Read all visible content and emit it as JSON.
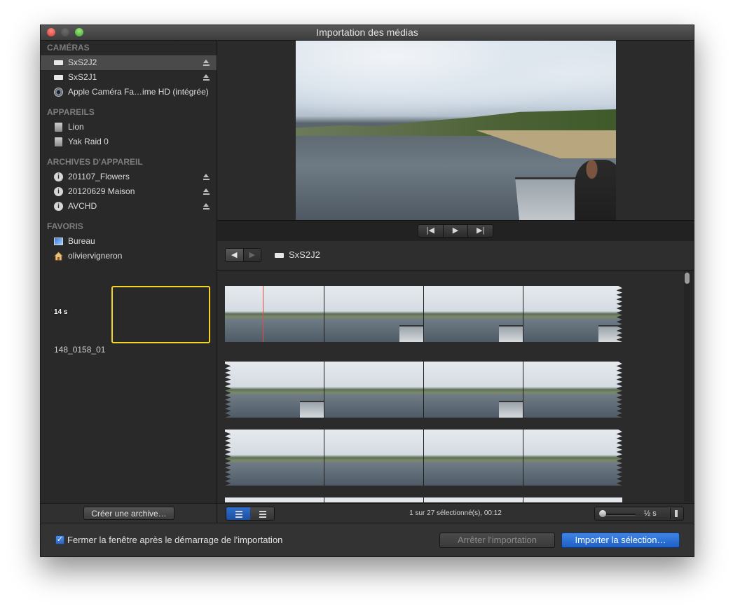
{
  "window": {
    "title": "Importation des médias"
  },
  "sidebar": {
    "sections": [
      {
        "title": "CAMÉRAS",
        "items": [
          {
            "label": "SxS2J2",
            "icon": "camera-icon",
            "eject": true,
            "selected": true
          },
          {
            "label": "SxS2J1",
            "icon": "camera-icon",
            "eject": true,
            "selected": false
          },
          {
            "label": "Apple Caméra Fa…ime HD (intégrée)",
            "icon": "facetime-camera-icon",
            "eject": false,
            "selected": false
          }
        ]
      },
      {
        "title": "APPAREILS",
        "items": [
          {
            "label": "Lion",
            "icon": "hard-disk-icon",
            "eject": false
          },
          {
            "label": "Yak Raid 0",
            "icon": "hard-disk-icon",
            "eject": false
          }
        ]
      },
      {
        "title": "ARCHIVES D'APPAREIL",
        "items": [
          {
            "label": "201107_Flowers",
            "icon": "archive-icon",
            "eject": true
          },
          {
            "label": "20120629 Maison",
            "icon": "archive-icon",
            "eject": true
          },
          {
            "label": "AVCHD",
            "icon": "archive-icon",
            "eject": true
          }
        ]
      },
      {
        "title": "FAVORIS",
        "items": [
          {
            "label": "Bureau",
            "icon": "desktop-icon",
            "eject": false
          },
          {
            "label": "oliviervigneron",
            "icon": "home-icon",
            "eject": false
          }
        ]
      }
    ],
    "archive_button": "Créer une archive…"
  },
  "transport": {
    "prev": "|◀",
    "play": "▶",
    "next": "▶|"
  },
  "navbar": {
    "back": "◀",
    "forward": "▶",
    "location": "SxS2J2"
  },
  "browser": {
    "clip_duration": "14 s",
    "clip_name": "148_0158_01",
    "status": "1 sur 27 sélectionné(s), 00:12",
    "zoom_label": "½ s"
  },
  "footer": {
    "checkbox_label": "Fermer la fenêtre après le démarrage de l'importation",
    "checkbox_checked": true,
    "stop_button": "Arrêter l'importation",
    "import_button": "Importer la sélection…"
  },
  "colors": {
    "accent": "#2f6fcf",
    "selection": "#f3d52a",
    "playhead": "#e84a4a"
  }
}
